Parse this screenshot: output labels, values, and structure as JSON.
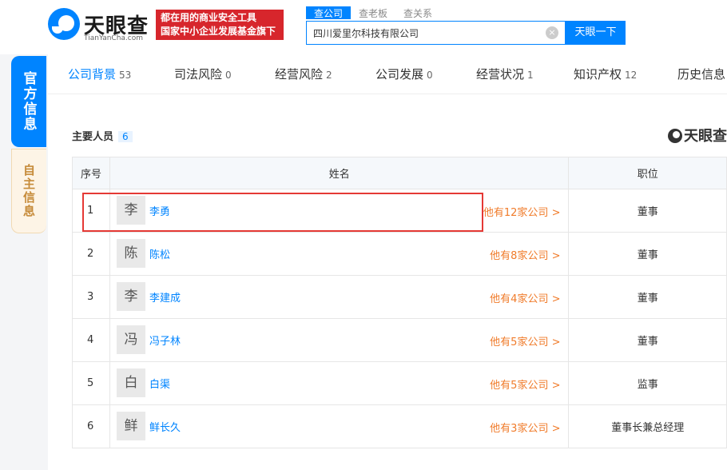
{
  "header": {
    "logo_name": "天眼查",
    "logo_domain": "TianYanCha.com",
    "banner_line1": "都在用的商业安全工具",
    "banner_line2": "国家中小企业发展基金旗下",
    "search_tabs": [
      "查公司",
      "查老板",
      "查关系"
    ],
    "search_value": "四川爱里尔科技有限公司",
    "search_button": "天眼一下"
  },
  "sidebar": {
    "tabs": [
      "官方信息",
      "自主信息"
    ]
  },
  "nav": {
    "tabs": [
      {
        "label": "公司背景",
        "count": "53"
      },
      {
        "label": "司法风险",
        "count": "0"
      },
      {
        "label": "经营风险",
        "count": "2"
      },
      {
        "label": "公司发展",
        "count": "0"
      },
      {
        "label": "经营状况",
        "count": "1"
      },
      {
        "label": "知识产权",
        "count": "12"
      },
      {
        "label": "历史信息",
        "count": ""
      }
    ]
  },
  "section": {
    "title": "主要人员",
    "count": "6",
    "watermark": "天眼查"
  },
  "table": {
    "headers": [
      "序号",
      "姓名",
      "职位"
    ],
    "rows": [
      {
        "no": "1",
        "avatar": "李",
        "name": "李勇",
        "companies": "他有12家公司 >",
        "position": "董事"
      },
      {
        "no": "2",
        "avatar": "陈",
        "name": "陈松",
        "companies": "他有8家公司 >",
        "position": "董事"
      },
      {
        "no": "3",
        "avatar": "李",
        "name": "李建成",
        "companies": "他有4家公司 >",
        "position": "董事"
      },
      {
        "no": "4",
        "avatar": "冯",
        "name": "冯子林",
        "companies": "他有5家公司 >",
        "position": "董事"
      },
      {
        "no": "5",
        "avatar": "白",
        "name": "白渠",
        "companies": "他有5家公司 >",
        "position": "监事"
      },
      {
        "no": "6",
        "avatar": "鲜",
        "name": "鲜长久",
        "companies": "他有3家公司 >",
        "position": "董事长兼总经理"
      }
    ]
  },
  "colors": {
    "accent": "#0084ff",
    "banner": "#d7262c",
    "company_link": "#f07b2a",
    "highlight_box": "#e53935"
  }
}
